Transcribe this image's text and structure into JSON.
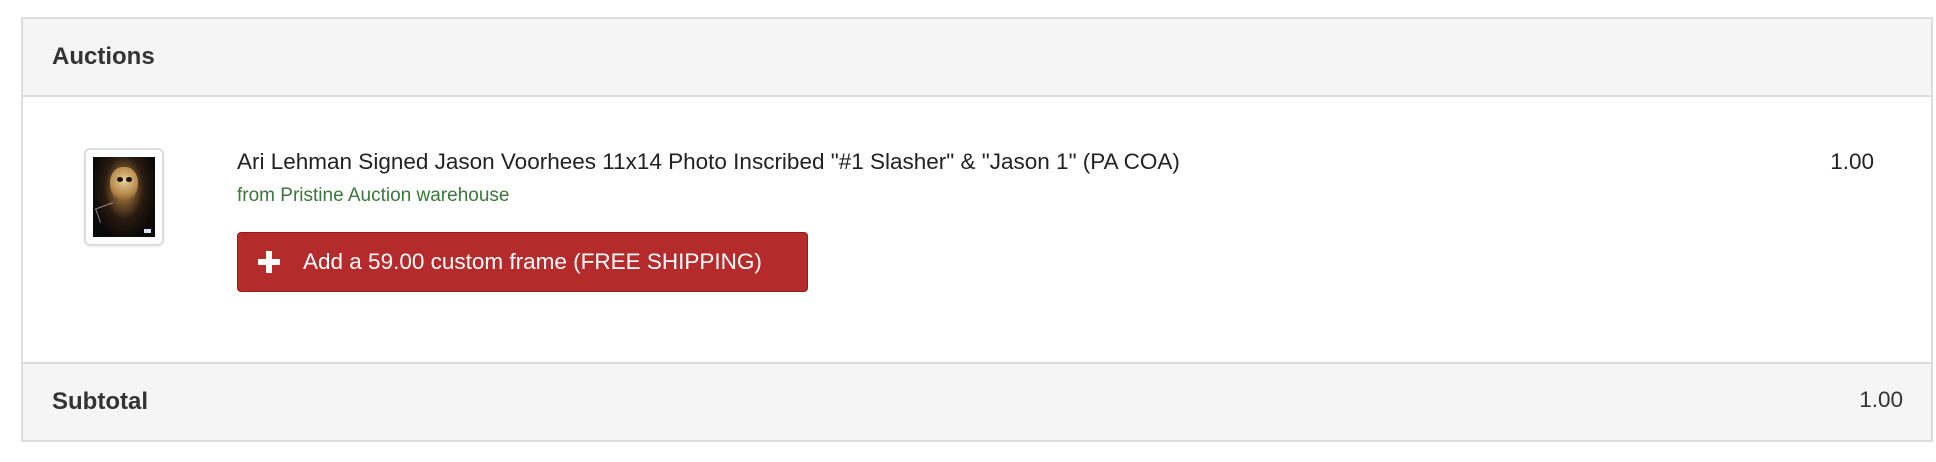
{
  "section": {
    "title": "Auctions"
  },
  "item": {
    "title": "Ari Lehman Signed Jason Voorhees 11x14 Photo Inscribed \"#1 Slasher\" & \"Jason 1\" (PA COA)",
    "seller": "from Pristine Auction warehouse",
    "price": "1.00",
    "thumbnail_icon": "jason-mask-photo-thumbnail"
  },
  "frame_offer": {
    "icon": "plus-icon",
    "label": "Add a 59.00 custom frame (FREE SHIPPING)",
    "color": "#b52b2b"
  },
  "subtotal": {
    "label": "Subtotal",
    "amount": "1.00"
  },
  "colors": {
    "seller_green": "#3c763d",
    "header_bg": "#f5f5f5",
    "border": "#dddddd"
  }
}
